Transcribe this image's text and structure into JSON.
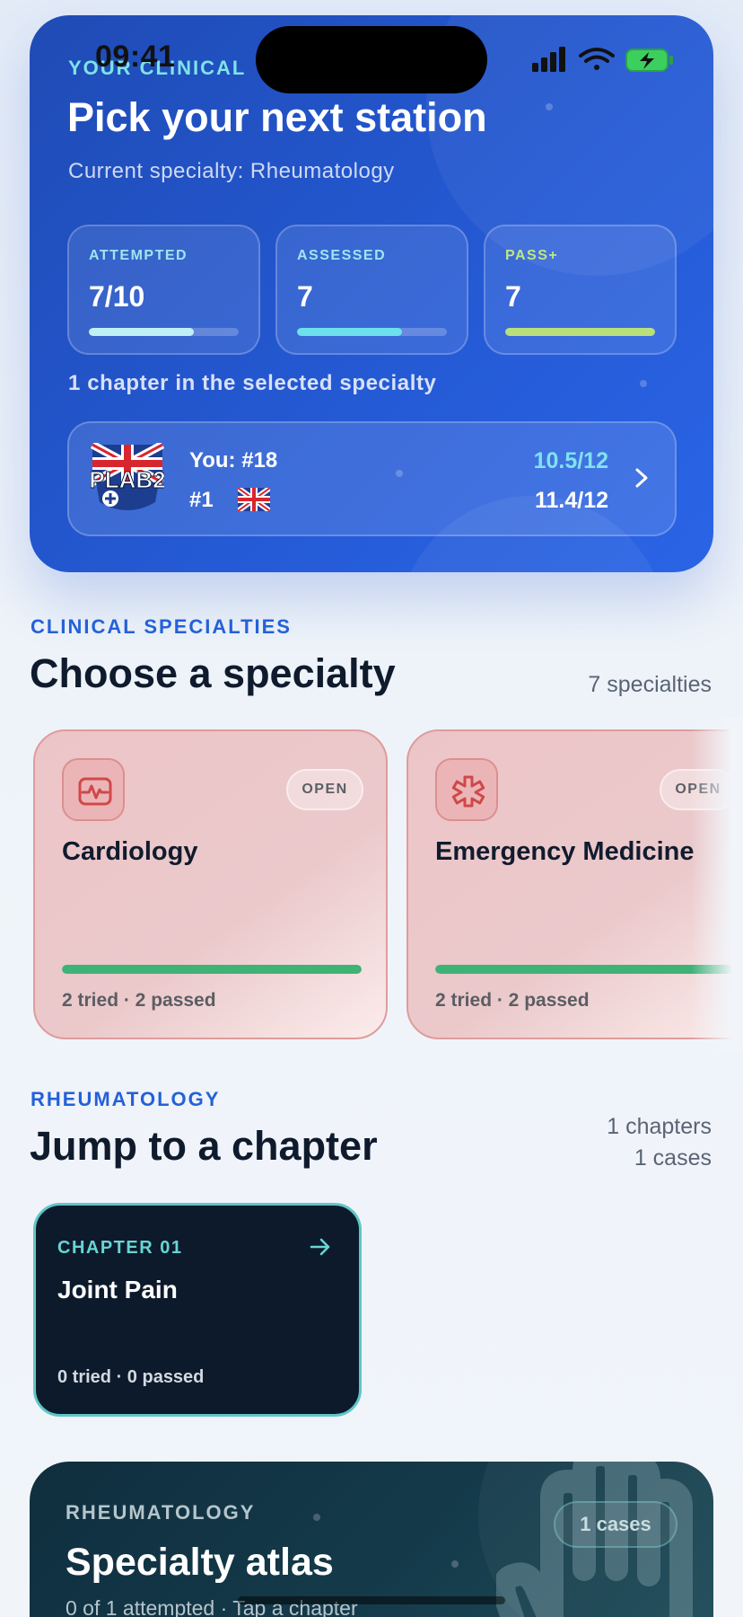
{
  "status_bar": {
    "time": "09:41"
  },
  "hero": {
    "eyebrow": "YOUR CLINICAL",
    "title": "Pick your next station",
    "subtitle": "Current specialty: Rheumatology",
    "stats": [
      {
        "label": "ATTEMPTED",
        "value": "7/10",
        "progress": 0.7
      },
      {
        "label": "ASSESSED",
        "value": "7",
        "progress": 0.7
      },
      {
        "label": "PASS+",
        "value": "7",
        "progress": 1.0
      }
    ],
    "chapters_note": "1 chapter in the selected specialty",
    "leaderboard": {
      "logo_text": "PLAB2",
      "you_rank": "You: #18",
      "top_rank": "#1",
      "you_score": "10.5/12",
      "top_score": "11.4/12"
    }
  },
  "specialties": {
    "eyebrow": "CLINICAL SPECIALTIES",
    "title": "Choose a specialty",
    "count": "7 specialties",
    "items": [
      {
        "name": "Cardiology",
        "badge": "OPEN",
        "meta": "2 tried · 2 passed",
        "progress": 1.0,
        "icon": "heart-monitor-icon"
      },
      {
        "name": "Emergency Medicine",
        "badge": "OPEN",
        "meta": "2 tried · 2 passed",
        "progress": 1.0,
        "icon": "star-of-life-icon"
      }
    ]
  },
  "chapters": {
    "eyebrow": "RHEUMATOLOGY",
    "title": "Jump to a chapter",
    "count_chapters": "1 chapters",
    "count_cases": "1 cases",
    "items": [
      {
        "label": "CHAPTER 01",
        "title": "Joint Pain",
        "meta": "0 tried · 0 passed"
      }
    ]
  },
  "atlas": {
    "eyebrow": "RHEUMATOLOGY",
    "title": "Specialty atlas",
    "subtitle": "0 of 1 attempted · Tap a chapter",
    "badge": "1 cases",
    "icon": "hand-icon"
  },
  "colors": {
    "accent_blue": "#2461d8",
    "hero_bg": "#2459d3",
    "success_green": "#3fb276",
    "teal": "#68d5d3"
  }
}
